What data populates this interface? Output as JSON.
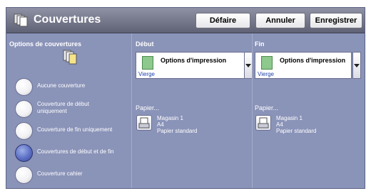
{
  "header": {
    "title": "Couvertures",
    "icon": "covers-icon",
    "buttons": {
      "undo": "Défaire",
      "cancel": "Annuler",
      "save": "Enregistrer"
    }
  },
  "options": {
    "heading": "Options de couvertures",
    "items": [
      {
        "label": "Aucune couverture",
        "selected": false
      },
      {
        "label": "Couverture de début uniquement",
        "selected": false
      },
      {
        "label": "Couverture de fin uniquement",
        "selected": false
      },
      {
        "label": "Couvertures de début et de fin",
        "selected": true
      },
      {
        "label": "Couverture cahier",
        "selected": false
      }
    ]
  },
  "front": {
    "heading": "Début",
    "dropdown": {
      "label": "Options d'impression",
      "value": "Vierge"
    },
    "paper": {
      "label": "Papier...",
      "tray": "Magasin 1",
      "size": "A4",
      "type": "Papier standard"
    }
  },
  "back": {
    "heading": "Fin",
    "dropdown": {
      "label": "Options d'impression",
      "value": "Vierge"
    },
    "paper": {
      "label": "Papier...",
      "tray": "Magasin 1",
      "size": "A4",
      "type": "Papier standard"
    }
  },
  "colors": {
    "panel": "#8a93b8",
    "header": "#6e7183",
    "accent": "#5c6fc4",
    "swatch": "#8dc88d"
  }
}
